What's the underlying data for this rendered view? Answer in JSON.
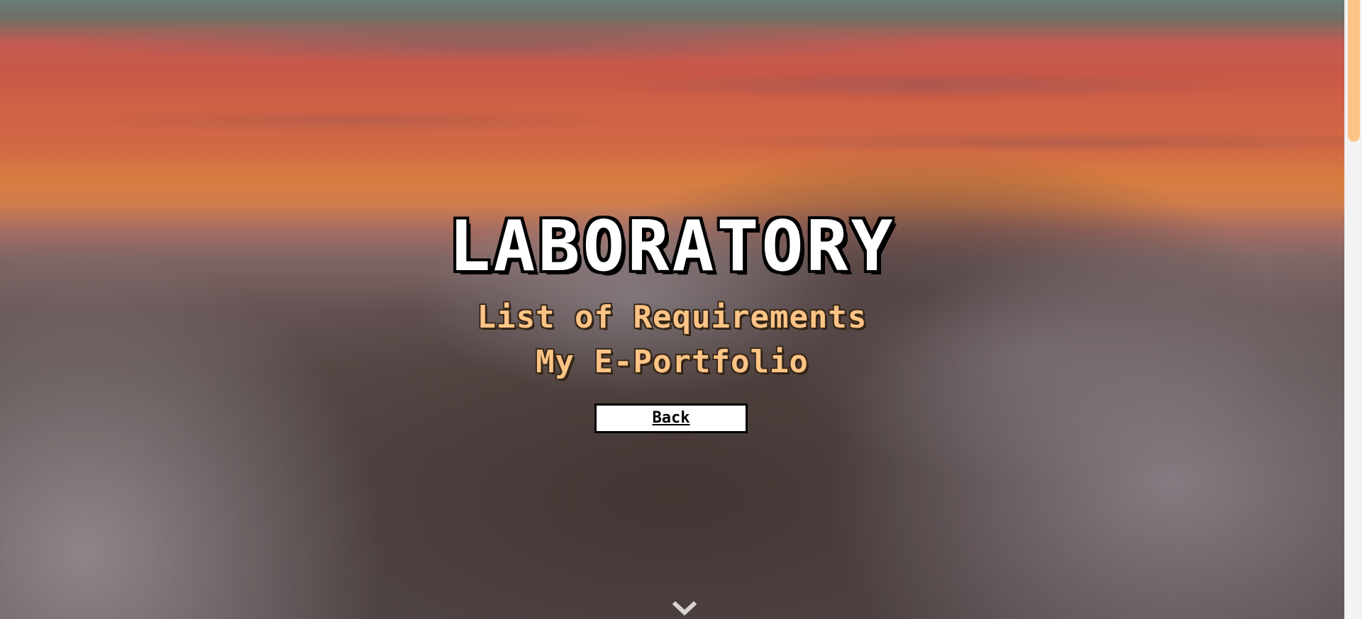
{
  "hero": {
    "title": "LABORATORY",
    "subtitle_1": "List of Requirements",
    "subtitle_2": "My E-Portfolio",
    "back_label": "Back"
  },
  "icons": {
    "scroll_down": "chevron-down-icon"
  },
  "colors": {
    "accent": "#fec486",
    "title_text": "#ffffff",
    "button_bg": "#ffffff",
    "button_border": "#000000",
    "scrollbar_thumb": "#fec486"
  }
}
